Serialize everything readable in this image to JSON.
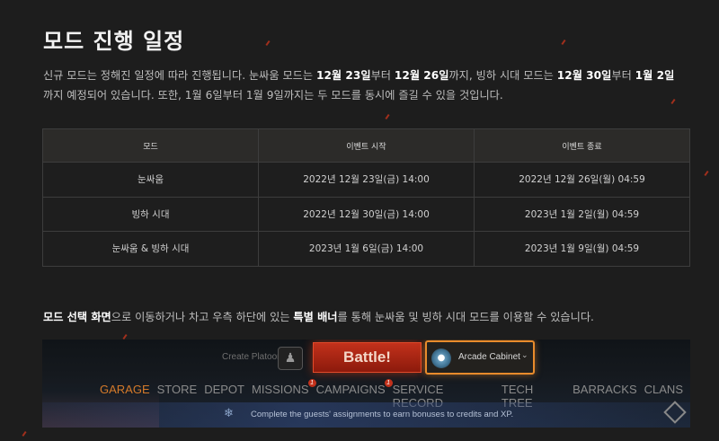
{
  "page": {
    "title": "모드 진행 일정",
    "intro_parts": [
      {
        "text": "신규 모드는 정해진 일정에 따라 진행됩니다. 눈싸움 모드는 ",
        "bold": false
      },
      {
        "text": "12월 23일",
        "bold": true
      },
      {
        "text": "부터 ",
        "bold": false
      },
      {
        "text": "12월 26일",
        "bold": true
      },
      {
        "text": "까지, 빙하 시대 모드는 ",
        "bold": false
      },
      {
        "text": "12월 30일",
        "bold": true
      },
      {
        "text": "부터 ",
        "bold": false
      },
      {
        "text": "1월 2일",
        "bold": true
      },
      {
        "text": "까지 예정되어 있습니다. 또한, 1월 6일부터 1월 9일까지는 두 모드를 동시에 즐길 수 있을 것입니다.",
        "bold": false
      }
    ],
    "outro_parts": [
      {
        "text": "모드 선택 화면",
        "bold": true
      },
      {
        "text": "으로 이동하거나 차고 우측 하단에 있는 ",
        "bold": false
      },
      {
        "text": "특별 배너",
        "bold": true
      },
      {
        "text": "를 통해 눈싸움 및 빙하 시대 모드를 이용할 수 있습니다.",
        "bold": false
      }
    ]
  },
  "schedule": {
    "headers": [
      "모드",
      "이벤트 시작",
      "이벤트 종료"
    ],
    "rows": [
      [
        "눈싸움",
        "2022년 12월 23일(금) 14:00",
        "2022년 12월 26일(월) 04:59"
      ],
      [
        "빙하 시대",
        "2022년 12월 30일(금) 14:00",
        "2023년 1월 2일(월) 04:59"
      ],
      [
        "눈싸움 & 빙하 시대",
        "2023년 1월 6일(금) 14:00",
        "2023년 1월 9일(월) 04:59"
      ]
    ]
  },
  "game_ui": {
    "create_platoon": "Create Platoon",
    "battle": "Battle!",
    "mode": "Arcade Cabinet",
    "nav": [
      {
        "label": "GARAGE",
        "active": true,
        "badge": ""
      },
      {
        "label": "STORE",
        "active": false,
        "badge": ""
      },
      {
        "label": "DEPOT",
        "active": false,
        "badge": ""
      },
      {
        "label": "MISSIONS",
        "active": false,
        "badge": "1"
      },
      {
        "label": "CAMPAIGNS",
        "active": false,
        "badge": "1"
      },
      {
        "label": "SERVICE RECORD",
        "active": false,
        "badge": ""
      },
      {
        "label": "TECH TREE",
        "active": false,
        "badge": ""
      },
      {
        "label": "BARRACKS",
        "active": false,
        "badge": ""
      },
      {
        "label": "CLANS",
        "active": false,
        "badge": ""
      }
    ],
    "banner_text": "Complete the guests' assignments to earn bonuses to credits and XP.",
    "colors": {
      "accent": "#d57a2a",
      "battle": "#c2311b",
      "mode_border": "#e88b2c"
    }
  }
}
